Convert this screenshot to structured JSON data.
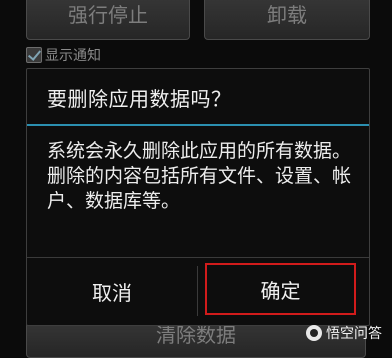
{
  "background": {
    "force_stop_label": "强行停止",
    "uninstall_label": "卸载",
    "show_notifications_label": "显示通知",
    "clear_data_label": "清除数据"
  },
  "dialog": {
    "title": "要删除应用数据吗？",
    "message": "系统会永久删除此应用的所有数据。删除的内容包括所有文件、设置、帐户、数据库等。",
    "cancel_label": "取消",
    "ok_label": "确定",
    "accent_color": "#2b8fb0",
    "highlight_color": "#d11b1b"
  },
  "watermark": {
    "text": "悟空问答",
    "icon": "wukong-logo-icon"
  }
}
